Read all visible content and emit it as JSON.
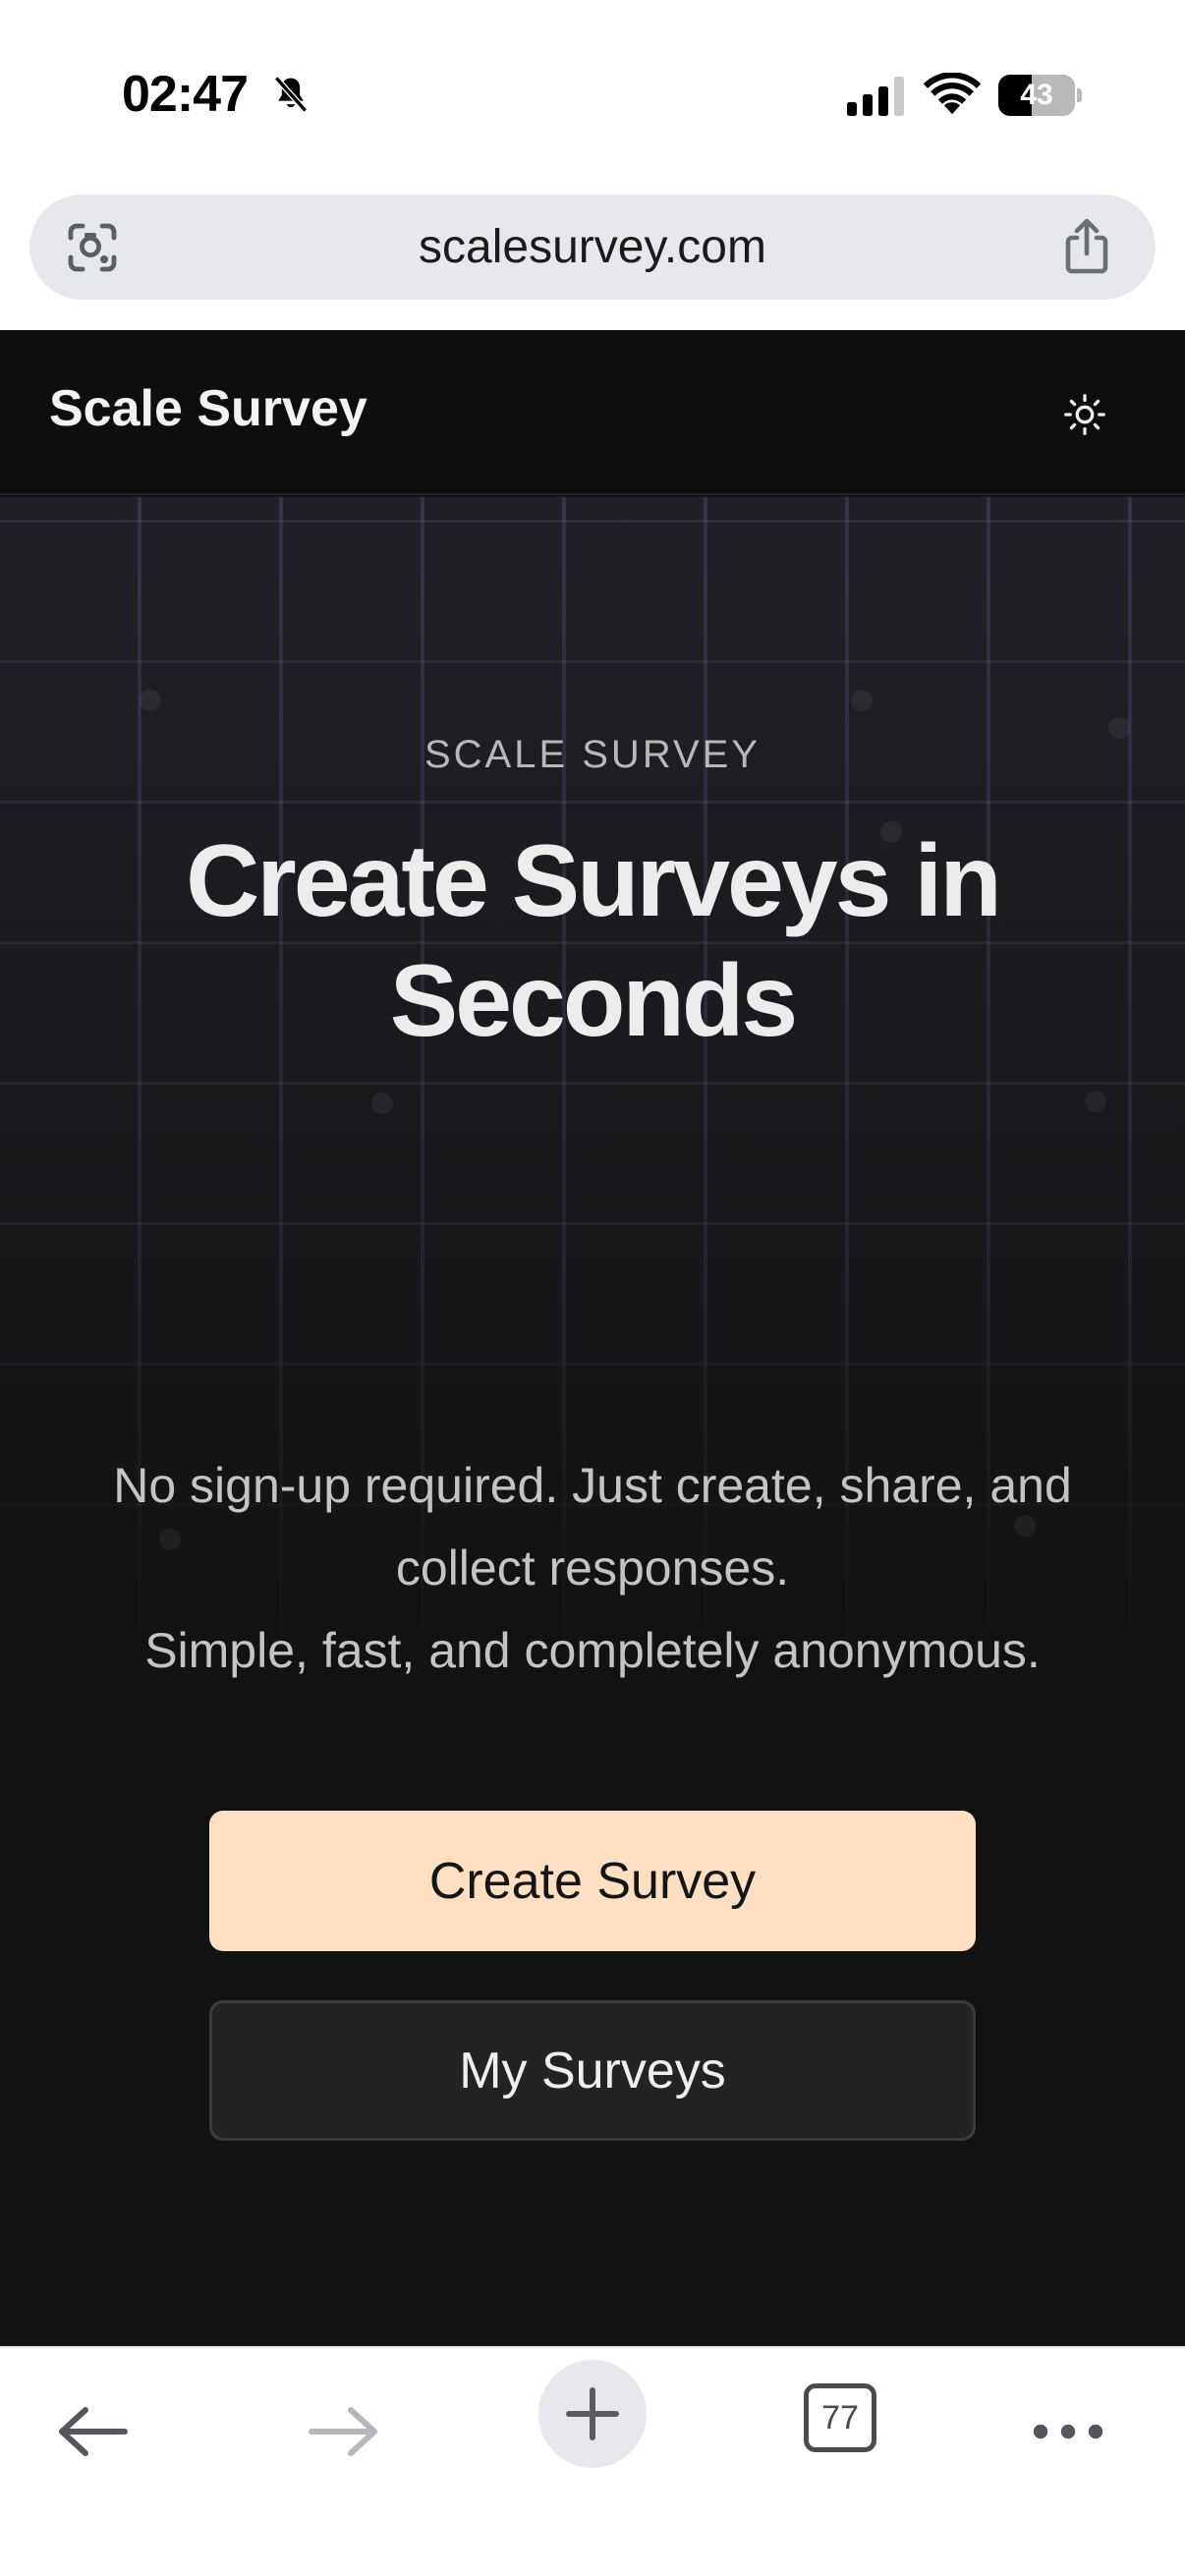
{
  "status_bar": {
    "time": "02:47",
    "battery_level": "43",
    "battery_fraction": 0.43
  },
  "browser": {
    "url": "scalesurvey.com",
    "tab_count": "77",
    "icons": [
      "lens-icon",
      "share-icon",
      "back-arrow-icon",
      "forward-arrow-icon",
      "plus-icon",
      "tabs-icon",
      "more-dots-icon"
    ]
  },
  "header": {
    "brand": "Scale Survey",
    "theme_icon": "sun-icon"
  },
  "hero": {
    "eyebrow": "SCALE SURVEY",
    "headline": "Create Surveys in Seconds",
    "subtitle_line1": "No sign-up required. Just create, share, and collect responses.",
    "subtitle_line2": "Simple, fast, and completely anonymous.",
    "primary_button": "Create Survey",
    "secondary_button": "My Surveys"
  },
  "colors": {
    "page_background": "#121212",
    "primary_button": "#fddfc2",
    "secondary_button": "#232324",
    "url_bar": "#e6e8eb"
  }
}
